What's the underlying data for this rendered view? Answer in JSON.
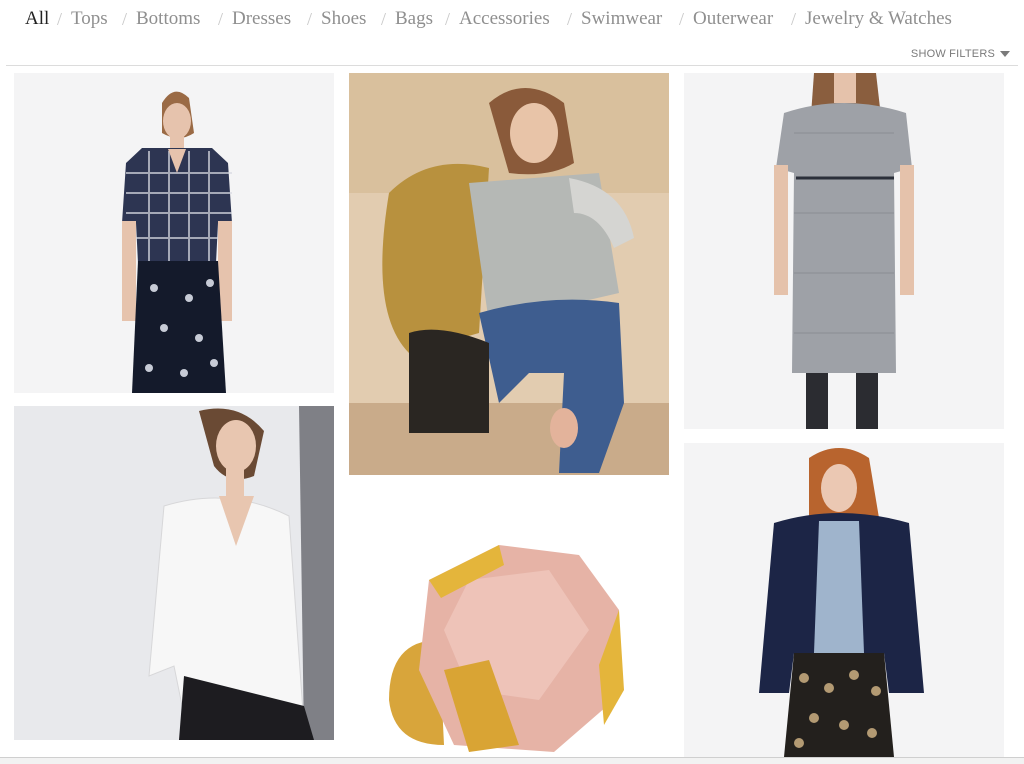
{
  "nav": {
    "items": [
      {
        "label": "All",
        "active": true
      },
      {
        "label": "Tops",
        "active": false
      },
      {
        "label": "Bottoms",
        "active": false
      },
      {
        "label": "Dresses",
        "active": false
      },
      {
        "label": "Shoes",
        "active": false
      },
      {
        "label": "Bags",
        "active": false
      },
      {
        "label": "Accessories",
        "active": false
      },
      {
        "label": "Swimwear",
        "active": false
      },
      {
        "label": "Outerwear",
        "active": false
      },
      {
        "label": "Jewelry & Watches",
        "active": false
      }
    ],
    "separator": "/"
  },
  "filters": {
    "label": "SHOW FILTERS",
    "icon": "caret-down-icon"
  },
  "colors": {
    "nav_active": "#222222",
    "nav_inactive": "#8f8f8f",
    "tile_bg": "#f4f4f5"
  }
}
